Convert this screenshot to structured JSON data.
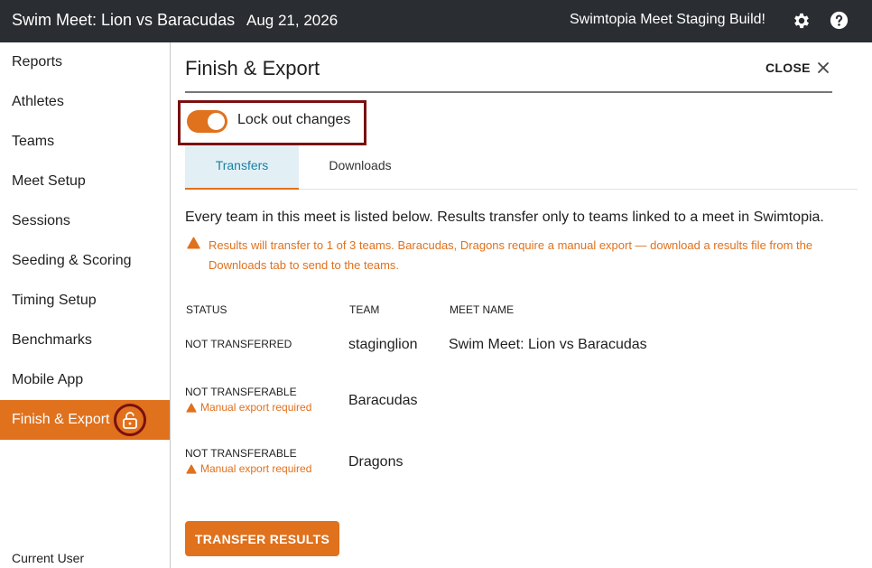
{
  "header": {
    "meet_title": "Swim Meet: Lion vs Baracudas",
    "meet_date": "Aug 21, 2026",
    "build_label": "Swimtopia Meet Staging Build!",
    "icons": [
      "gear-icon",
      "help-icon"
    ]
  },
  "sidebar": {
    "items": [
      {
        "label": "Reports"
      },
      {
        "label": "Athletes"
      },
      {
        "label": "Teams"
      },
      {
        "label": "Meet Setup"
      },
      {
        "label": "Sessions"
      },
      {
        "label": "Seeding & Scoring"
      },
      {
        "label": "Timing Setup"
      },
      {
        "label": "Benchmarks"
      },
      {
        "label": "Mobile App"
      },
      {
        "label": "Finish & Export",
        "active": true,
        "icon": "lock-open-icon"
      }
    ],
    "current_user_label": "Current User"
  },
  "main": {
    "title": "Finish & Export",
    "close_label": "CLOSE",
    "lock_toggle": {
      "label": "Lock out changes",
      "on": true
    },
    "tabs": [
      {
        "label": "Transfers",
        "active": true
      },
      {
        "label": "Downloads",
        "active": false
      }
    ],
    "intro": "Every team in this meet is listed below. Results transfer only to teams linked to a meet in Swimtopia.",
    "warning": "Results will transfer to 1 of 3 teams. Baracudas, Dragons require a manual export — download a results file from the Downloads tab to send to the teams.",
    "table": {
      "columns": [
        "STATUS",
        "TEAM",
        "MEET NAME"
      ],
      "rows": [
        {
          "status": "NOT TRANSFERRED",
          "substatus": "",
          "team": "staginglion",
          "meet_name": "Swim Meet: Lion vs Baracudas"
        },
        {
          "status": "NOT TRANSFERABLE",
          "substatus": "Manual export required",
          "team": "Baracudas",
          "meet_name": ""
        },
        {
          "status": "NOT TRANSFERABLE",
          "substatus": "Manual export required",
          "team": "Dragons",
          "meet_name": ""
        }
      ]
    },
    "transfer_button_label": "TRANSFER RESULTS"
  },
  "colors": {
    "accent": "#e0711d",
    "topbar": "#2a2d31",
    "active_tab_bg": "#e2f0f6",
    "active_tab_text": "#1b7fa3",
    "highlight_outline": "#7a1010"
  }
}
